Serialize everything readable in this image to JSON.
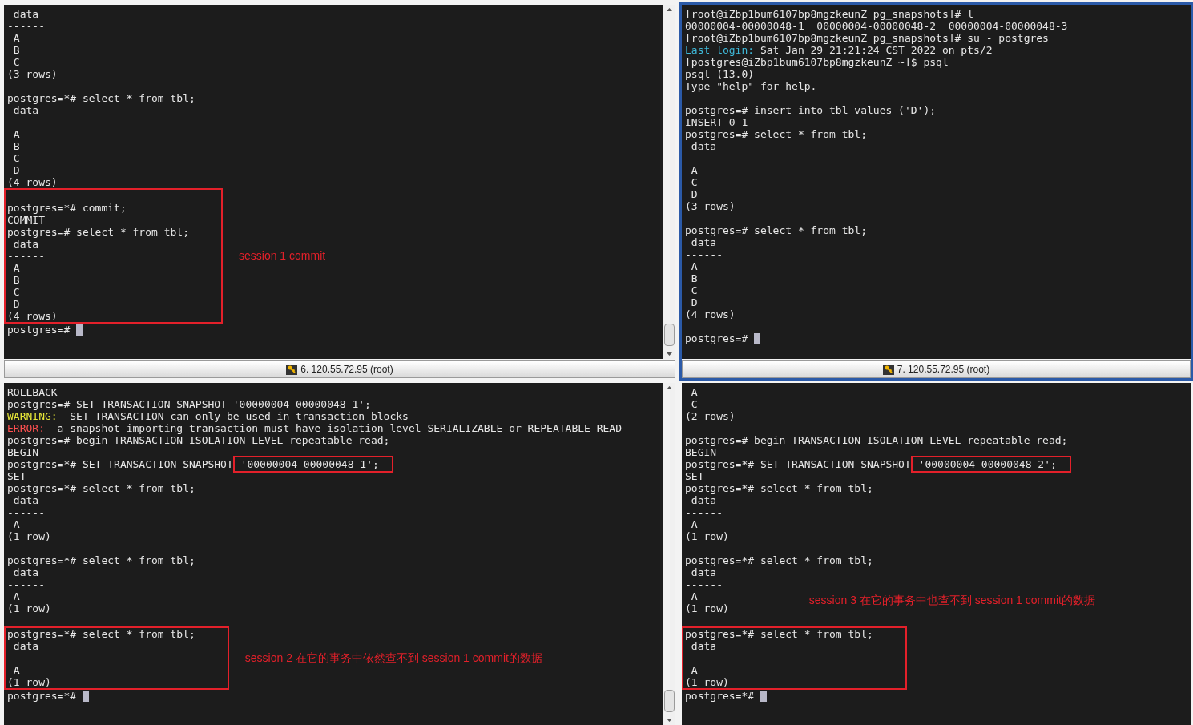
{
  "panes": [
    {
      "active": false,
      "scrollbar": true,
      "status": "6. 120.55.72.95 (root)",
      "prompt": "postgres=# ",
      "blocks": [
        {
          "boxed": false,
          "lines": [
            {
              "kind": "text",
              "text": " data"
            },
            {
              "kind": "text",
              "text": "------"
            },
            {
              "kind": "text",
              "text": " A"
            },
            {
              "kind": "text",
              "text": " B"
            },
            {
              "kind": "text",
              "text": " C"
            },
            {
              "kind": "text",
              "text": "(3 rows)"
            },
            {
              "kind": "blank"
            },
            {
              "kind": "text",
              "text": "postgres=*# select * from tbl;"
            },
            {
              "kind": "text",
              "text": " data"
            },
            {
              "kind": "text",
              "text": "------"
            },
            {
              "kind": "text",
              "text": " A"
            },
            {
              "kind": "text",
              "text": " B"
            },
            {
              "kind": "text",
              "text": " C"
            },
            {
              "kind": "text",
              "text": " D"
            },
            {
              "kind": "text",
              "text": "(4 rows)"
            }
          ]
        },
        {
          "boxed": true,
          "note": "session 1 commit",
          "lines": [
            {
              "kind": "blank"
            },
            {
              "kind": "text",
              "text": "postgres=*# commit;"
            },
            {
              "kind": "text",
              "text": "COMMIT"
            },
            {
              "kind": "text",
              "text": "postgres=# select * from tbl;"
            },
            {
              "kind": "text",
              "text": " data"
            },
            {
              "kind": "text",
              "text": "------"
            },
            {
              "kind": "text",
              "text": " A"
            },
            {
              "kind": "text",
              "text": " B"
            },
            {
              "kind": "text",
              "text": " C"
            },
            {
              "kind": "text",
              "text": " D"
            },
            {
              "kind": "text",
              "text": "(4 rows)"
            }
          ]
        }
      ]
    },
    {
      "active": true,
      "scrollbar": false,
      "status": "7. 120.55.72.95 (root)",
      "prompt": "postgres=# ",
      "blocks": [
        {
          "boxed": false,
          "lines": [
            {
              "kind": "text",
              "text": "[root@iZbp1bum6107bp8mgzkeunZ pg_snapshots]# l"
            },
            {
              "kind": "text",
              "text": "00000004-00000048-1  00000004-00000048-2  00000004-00000048-3"
            },
            {
              "kind": "text",
              "text": "[root@iZbp1bum6107bp8mgzkeunZ pg_snapshots]# su - postgres"
            },
            {
              "kind": "segments",
              "segments": [
                {
                  "kind": "login",
                  "text": "Last login:"
                },
                {
                  "kind": "plain",
                  "text": " Sat Jan 29 21:21:24 CST 2022 on pts/2"
                }
              ]
            },
            {
              "kind": "text",
              "text": "[postgres@iZbp1bum6107bp8mgzkeunZ ~]$ psql"
            },
            {
              "kind": "text",
              "text": "psql (13.0)"
            },
            {
              "kind": "text",
              "text": "Type \"help\" for help."
            },
            {
              "kind": "blank"
            },
            {
              "kind": "text",
              "text": "postgres=# insert into tbl values ('D');"
            },
            {
              "kind": "text",
              "text": "INSERT 0 1"
            },
            {
              "kind": "text",
              "text": "postgres=# select * from tbl;"
            },
            {
              "kind": "text",
              "text": " data"
            },
            {
              "kind": "text",
              "text": "------"
            },
            {
              "kind": "text",
              "text": " A"
            },
            {
              "kind": "text",
              "text": " C"
            },
            {
              "kind": "text",
              "text": " D"
            },
            {
              "kind": "text",
              "text": "(3 rows)"
            },
            {
              "kind": "blank"
            },
            {
              "kind": "text",
              "text": "postgres=# select * from tbl;"
            },
            {
              "kind": "text",
              "text": " data"
            },
            {
              "kind": "text",
              "text": "------"
            },
            {
              "kind": "text",
              "text": " A"
            },
            {
              "kind": "text",
              "text": " B"
            },
            {
              "kind": "text",
              "text": " C"
            },
            {
              "kind": "text",
              "text": " D"
            },
            {
              "kind": "text",
              "text": "(4 rows)"
            },
            {
              "kind": "blank"
            }
          ]
        }
      ]
    },
    {
      "active": false,
      "scrollbar": true,
      "prompt": "postgres=*# ",
      "blocks": [
        {
          "boxed": false,
          "lines": [
            {
              "kind": "text",
              "text": "ROLLBACK"
            },
            {
              "kind": "text",
              "text": "postgres=# SET TRANSACTION SNAPSHOT '00000004-00000048-1';"
            },
            {
              "kind": "segments",
              "segments": [
                {
                  "kind": "warning",
                  "text": "WARNING:"
                },
                {
                  "kind": "plain",
                  "text": "  SET TRANSACTION can only be used in transaction blocks"
                }
              ]
            },
            {
              "kind": "segments",
              "segments": [
                {
                  "kind": "error",
                  "text": "ERROR:"
                },
                {
                  "kind": "plain",
                  "text": "  a snapshot-importing transaction must have isolation level SERIALIZABLE or REPEATABLE READ"
                }
              ]
            },
            {
              "kind": "text",
              "text": "postgres=# begin TRANSACTION ISOLATION LEVEL repeatable read;"
            },
            {
              "kind": "text",
              "text": "BEGIN"
            },
            {
              "kind": "segments",
              "segments": [
                {
                  "kind": "plain",
                  "text": "postgres=*# SET TRANSACTION SNAPSHOT"
                },
                {
                  "kind": "highlight",
                  "text": " '00000004-00000048-1';"
                }
              ]
            },
            {
              "kind": "text",
              "text": "SET"
            },
            {
              "kind": "text",
              "text": "postgres=*# select * from tbl;"
            },
            {
              "kind": "text",
              "text": " data"
            },
            {
              "kind": "text",
              "text": "------"
            },
            {
              "kind": "text",
              "text": " A"
            },
            {
              "kind": "text",
              "text": "(1 row)"
            },
            {
              "kind": "blank"
            },
            {
              "kind": "text",
              "text": "postgres=*# select * from tbl;"
            },
            {
              "kind": "text",
              "text": " data"
            },
            {
              "kind": "text",
              "text": "------"
            },
            {
              "kind": "text",
              "text": " A"
            },
            {
              "kind": "text",
              "text": "(1 row)"
            },
            {
              "kind": "blank"
            }
          ]
        },
        {
          "boxed": true,
          "note": "session 2 在它的事务中依然查不到 session 1 commit的数据",
          "lines": [
            {
              "kind": "text",
              "text": "postgres=*# select * from tbl;"
            },
            {
              "kind": "text",
              "text": " data"
            },
            {
              "kind": "text",
              "text": "------"
            },
            {
              "kind": "text",
              "text": " A"
            },
            {
              "kind": "text",
              "text": "(1 row)"
            }
          ]
        }
      ]
    },
    {
      "active": false,
      "scrollbar": false,
      "prompt": "postgres=*# ",
      "blocks": [
        {
          "boxed": false,
          "lines": [
            {
              "kind": "text",
              "text": " A"
            },
            {
              "kind": "text",
              "text": " C"
            },
            {
              "kind": "text",
              "text": "(2 rows)"
            },
            {
              "kind": "blank"
            },
            {
              "kind": "text",
              "text": "postgres=# begin TRANSACTION ISOLATION LEVEL repeatable read;"
            },
            {
              "kind": "text",
              "text": "BEGIN"
            },
            {
              "kind": "segments",
              "segments": [
                {
                  "kind": "plain",
                  "text": "postgres=*# SET TRANSACTION SNAPSHOT"
                },
                {
                  "kind": "highlight",
                  "text": " '00000004-00000048-2';"
                }
              ]
            },
            {
              "kind": "text",
              "text": "SET"
            },
            {
              "kind": "text",
              "text": "postgres=*# select * from tbl;"
            },
            {
              "kind": "text",
              "text": " data"
            },
            {
              "kind": "text",
              "text": "------"
            },
            {
              "kind": "text",
              "text": " A"
            },
            {
              "kind": "text",
              "text": "(1 row)"
            },
            {
              "kind": "blank"
            }
          ]
        },
        {
          "boxed": false,
          "note": "session 3 在它的事务中也查不到 session 1 commit的数据",
          "lines": [
            {
              "kind": "text",
              "text": "postgres=*# select * from tbl;"
            },
            {
              "kind": "text",
              "text": " data"
            },
            {
              "kind": "text",
              "text": "------"
            },
            {
              "kind": "text",
              "text": " A"
            },
            {
              "kind": "text",
              "text": "(1 row)"
            },
            {
              "kind": "blank"
            }
          ]
        },
        {
          "boxed": true,
          "lines": [
            {
              "kind": "text",
              "text": "postgres=*# select * from tbl;"
            },
            {
              "kind": "text",
              "text": " data"
            },
            {
              "kind": "text",
              "text": "------"
            },
            {
              "kind": "text",
              "text": " A"
            },
            {
              "kind": "text",
              "text": "(1 row)"
            }
          ]
        }
      ]
    }
  ]
}
